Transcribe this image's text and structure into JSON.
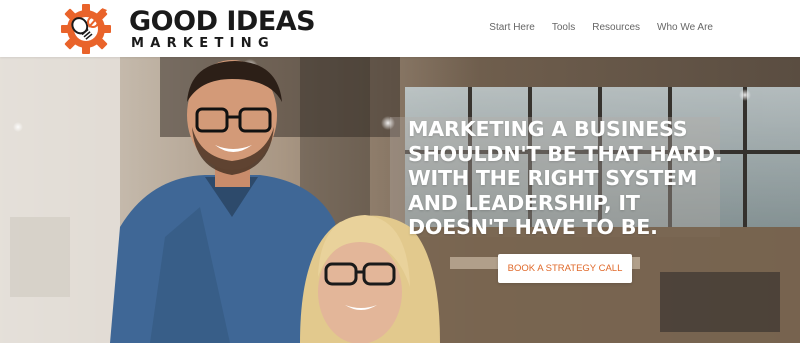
{
  "brand": {
    "line1": "GOOD IDEAS",
    "line2": "MARKETING",
    "accent": "#e9632a",
    "logo_icon": "gear-lightbulb-icon"
  },
  "nav": {
    "items": [
      {
        "label": "Start Here"
      },
      {
        "label": "Tools"
      },
      {
        "label": "Resources"
      },
      {
        "label": "Who We Are"
      }
    ]
  },
  "hero": {
    "headline_lines": [
      "MARKETING A BUSINESS",
      "SHOULDN'T BE THAT HARD.",
      "WITH THE RIGHT SYSTEM",
      "AND LEADERSHIP, IT",
      "DOESN'T HAVE TO BE."
    ],
    "cta_label": "BOOK A STRATEGY CALL",
    "cta_color": "#e0692a"
  }
}
